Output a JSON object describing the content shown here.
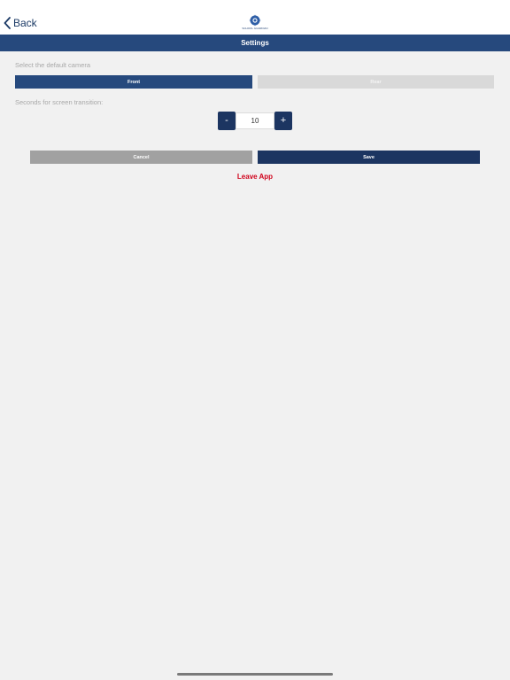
{
  "header": {
    "back_label": "Back",
    "logo_text": "SCHOOL GUARDIAN",
    "title": "Settings"
  },
  "camera": {
    "label": "Select the default camera",
    "options": [
      "Front",
      "Rear"
    ],
    "selected": "Front"
  },
  "transition": {
    "label": "Seconds for screen transition:",
    "value": "10",
    "decrement_symbol": "-",
    "increment_symbol": "+"
  },
  "actions": {
    "cancel_label": "Cancel",
    "save_label": "Save",
    "leave_label": "Leave App"
  },
  "colors": {
    "primary": "#26497d",
    "dark_primary": "#1c3561",
    "danger": "#d0021b"
  }
}
